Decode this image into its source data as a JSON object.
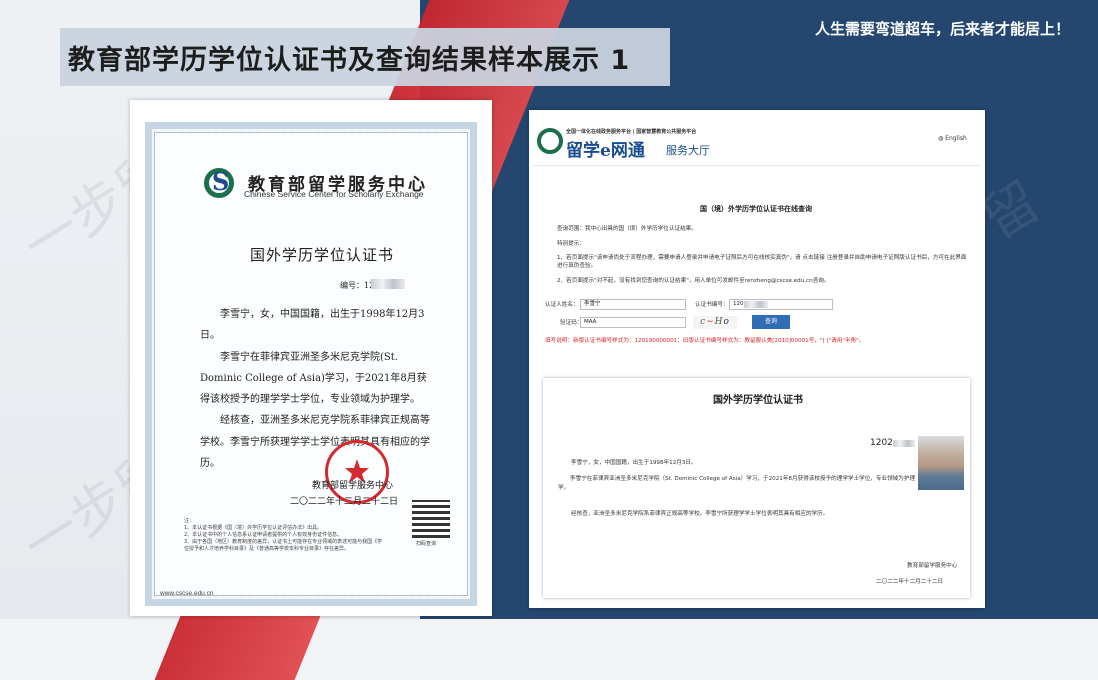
{
  "slide": {
    "title": "教育部学历学位认证书及查询结果样本展示 1",
    "slogan": "人生需要弯道超车，后来者才能居上！",
    "watermark": "一步留学"
  },
  "certificate": {
    "org_cn": "教育部留学服务中心",
    "org_en": "Chinese Service Center for Scholarly Exchange",
    "heading": "国外学历学位认证书",
    "number_label": "编号：120",
    "paragraphs": [
      "李雪宁，女，中国国籍，出生于1998年12月3日。",
      "李雪宁在菲律宾亚洲圣多米尼克学院(St. Dominic College of Asia)学习，于2021年8月获得该校授予的理学学士学位，专业领域为护理学。",
      "经核查，亚洲圣多米尼克学院系菲律宾正规高等学校。李雪宁所获理学学士学位表明其具有相应的学历。"
    ],
    "signer": "教育部留学服务中心",
    "date": "二〇二二年十二月二十二日",
    "qr_caption": "扫码查询",
    "notes": [
      "注：",
      "1、本认证书根据《国（境）外学历学位认证评估办法》出具。",
      "2、本认证书中的个人信息系认证申请者提供的个人有效身份证件信息。",
      "3、由于各国（地区）教育制度的差异，认证书上可能存在专业领域的表述可能与我国《学位授予和人才培养学科目录》及《普通高等学校本科专业目录》存在差异。"
    ],
    "website": "www.cscse.edu.cn"
  },
  "web": {
    "header_platform": "全国一体化在线政务服务平台 | 国家智慧教育公共服务平台",
    "brand": "留学e网通",
    "brand_suffix": "服务大厅",
    "lang": "English",
    "page_title": "国（境）外学历学位认证书在线查询",
    "scope_text": "查询范围：我中心出具的国（境）外学历学位认证结果。",
    "tips_label": "特别提示：",
    "tip1": "1、若页面提示\"该申请尚处于流程办理，需要申请人登录并申请电子证照后方可在线核实真伪\"，请 点击链接 注册登录并自助申请电子证照版认证书后，方可在此界面进行真伪查验。",
    "tip2": "2、若页面提示\"对不起，没有找到您查询的认证结果\"，用人单位可发邮件至renzheng@cscse.edu.cn咨询。",
    "name_label": "认证人姓名：",
    "name_value": "李雪宁",
    "cert_no_label": "认证书编号：",
    "cert_no_value": "120",
    "code_label": "验证码：",
    "code_value": "MAA",
    "search_button": "查询",
    "format_note": "填写说明：新版认证书编号样式为：120190000001；旧版认证书编号样式为：教留服认美[2010]00001号，\"[ ]\"请用\"半角\"。",
    "result": {
      "heading": "国外学历学位认证书",
      "number": "1202",
      "line1": "李雪宁，女，中国国籍，出生于1998年12月3日。",
      "line2": "李雪宁在菲律宾亚洲圣多米尼克学院（St. Dominic College of Asia）学习，于2021年8月获得该校授予的理学学士学位，专业领域为护理学。",
      "line3": "经核查，亚洲圣多米尼克学院系菲律宾正规高等学校。李雪宁所获理学学士学位表明其具有相应的学历。",
      "signer": "教育部留学服务中心",
      "date": "二〇二二年十二月二十二日"
    }
  },
  "colors": {
    "navy": "#24466f",
    "red": "#d42a2f",
    "green": "#1b6f4a",
    "blue_button": "#2f6db5"
  }
}
